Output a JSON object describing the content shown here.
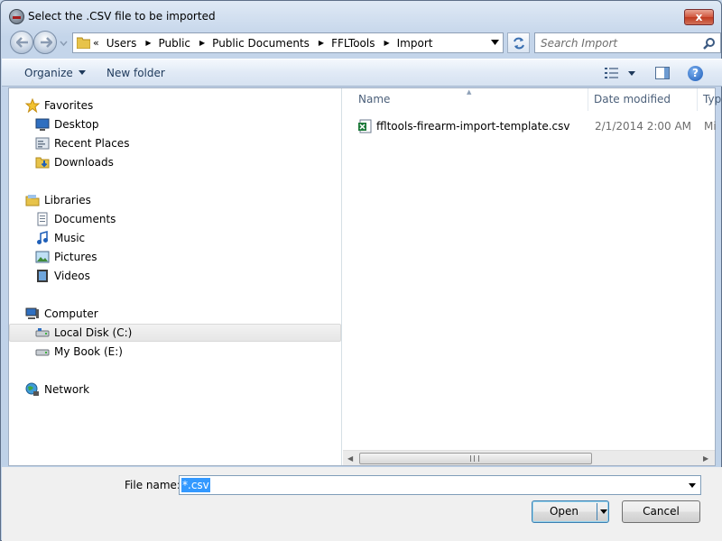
{
  "window": {
    "title": "Select the .CSV file to be imported",
    "close_label": "x"
  },
  "address": {
    "overflow": "«",
    "crumbs": [
      "Users",
      "Public",
      "Public Documents",
      "FFLTools",
      "Import"
    ]
  },
  "search": {
    "placeholder": "Search Import"
  },
  "toolbar": {
    "organize_label": "Organize",
    "new_folder_label": "New folder",
    "help_label": "?"
  },
  "nav": {
    "favorites": {
      "label": "Favorites",
      "items": [
        "Desktop",
        "Recent Places",
        "Downloads"
      ]
    },
    "libraries": {
      "label": "Libraries",
      "items": [
        "Documents",
        "Music",
        "Pictures",
        "Videos"
      ]
    },
    "computer": {
      "label": "Computer",
      "items": [
        "Local Disk (C:)",
        "My Book (E:)"
      ],
      "selected": "Local Disk (C:)"
    },
    "network": {
      "label": "Network"
    }
  },
  "files": {
    "columns": [
      "Name",
      "Date modified",
      "Typ"
    ],
    "rows": [
      {
        "name": "ffltools-firearm-import-template.csv",
        "date": "2/1/2014 2:00 AM",
        "type": "Mi"
      }
    ],
    "scroll_grip": "III"
  },
  "footer": {
    "file_name_label": "File name:",
    "file_name_value": "*.csv",
    "open_label": "Open",
    "cancel_label": "Cancel"
  },
  "colors": {
    "selection": "#3399ff",
    "link_text": "#1e395b",
    "window_bg": "#c4d5ea"
  }
}
